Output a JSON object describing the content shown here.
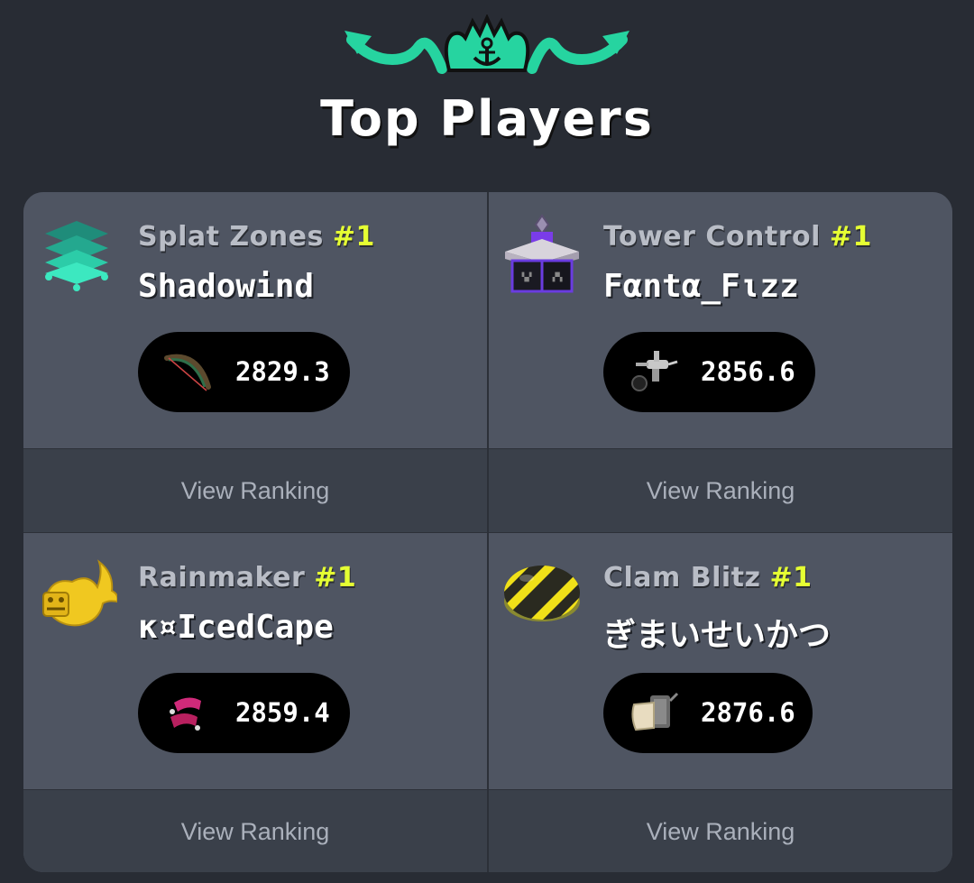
{
  "header": {
    "title": "Top Players",
    "emblem_icon": "splatoon-anchor-crown-emblem-icon",
    "accent_color": "#26d4a0"
  },
  "cards": [
    {
      "mode": "Splat Zones",
      "rank": "#1",
      "player": "Shadowind",
      "power": "2829.3",
      "mode_icon": "splat-zones-icon",
      "weapon_icon": "bow-weapon-icon",
      "link": "View Ranking"
    },
    {
      "mode": "Tower Control",
      "rank": "#1",
      "player": "Fαntα_Fιzz",
      "power": "2856.6",
      "mode_icon": "tower-control-icon",
      "weapon_icon": "airbrush-weapon-icon",
      "link": "View Ranking"
    },
    {
      "mode": "Rainmaker",
      "rank": "#1",
      "player": "κ¤IcedCape",
      "power": "2859.4",
      "mode_icon": "rainmaker-icon",
      "weapon_icon": "dualies-weapon-icon",
      "link": "View Ranking"
    },
    {
      "mode": "Clam Blitz",
      "rank": "#1",
      "player": "ぎまいせいかつ",
      "power": "2876.6",
      "mode_icon": "clam-blitz-icon",
      "weapon_icon": "roller-weapon-icon",
      "link": "View Ranking"
    }
  ],
  "colors": {
    "rank": "#e5ff33",
    "card_bg": "#4f5562",
    "footer_bg": "#3a404a",
    "page_bg": "#282c34"
  }
}
